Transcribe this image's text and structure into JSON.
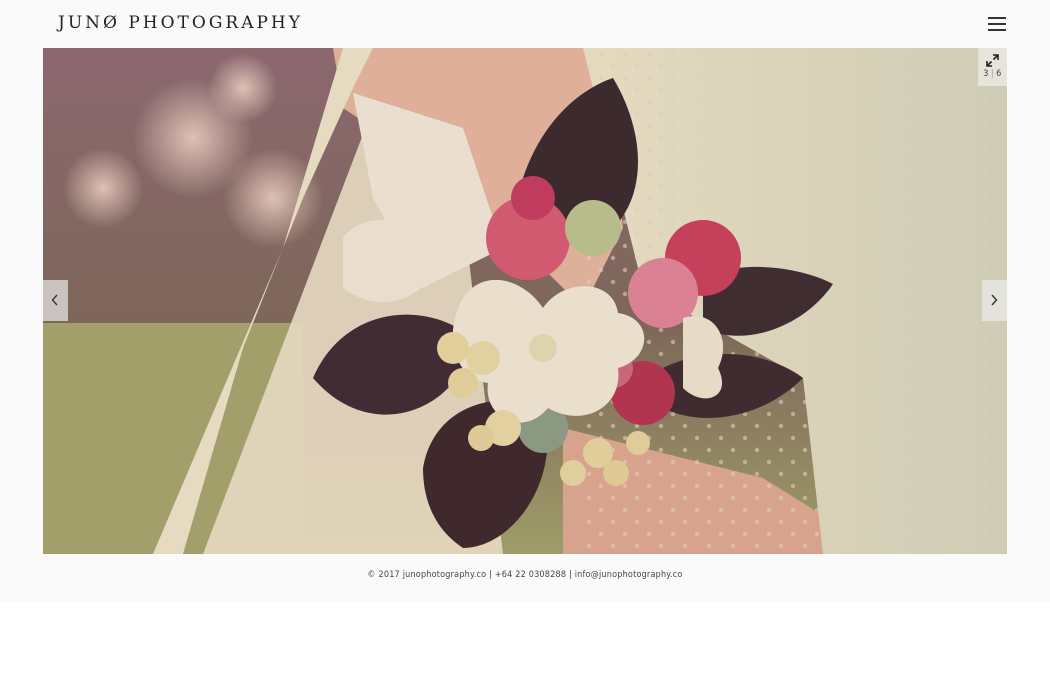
{
  "header": {
    "logo": "JUNØ PHOTOGRAPHY",
    "menu_icon": "hamburger-menu-icon"
  },
  "slider": {
    "current": "3",
    "separator": "|",
    "total": "6",
    "expand_icon": "expand-icon",
    "prev_icon": "chevron-left-icon",
    "next_icon": "chevron-right-icon"
  },
  "footer": {
    "copyright": "© 2017",
    "site_link": "junophotography.co",
    "sep1": "|",
    "phone": "+64 22 0308288",
    "sep2": "|",
    "email": "info@junophotography.co"
  },
  "colors": {
    "background": "#fafafa",
    "text": "#222222"
  }
}
